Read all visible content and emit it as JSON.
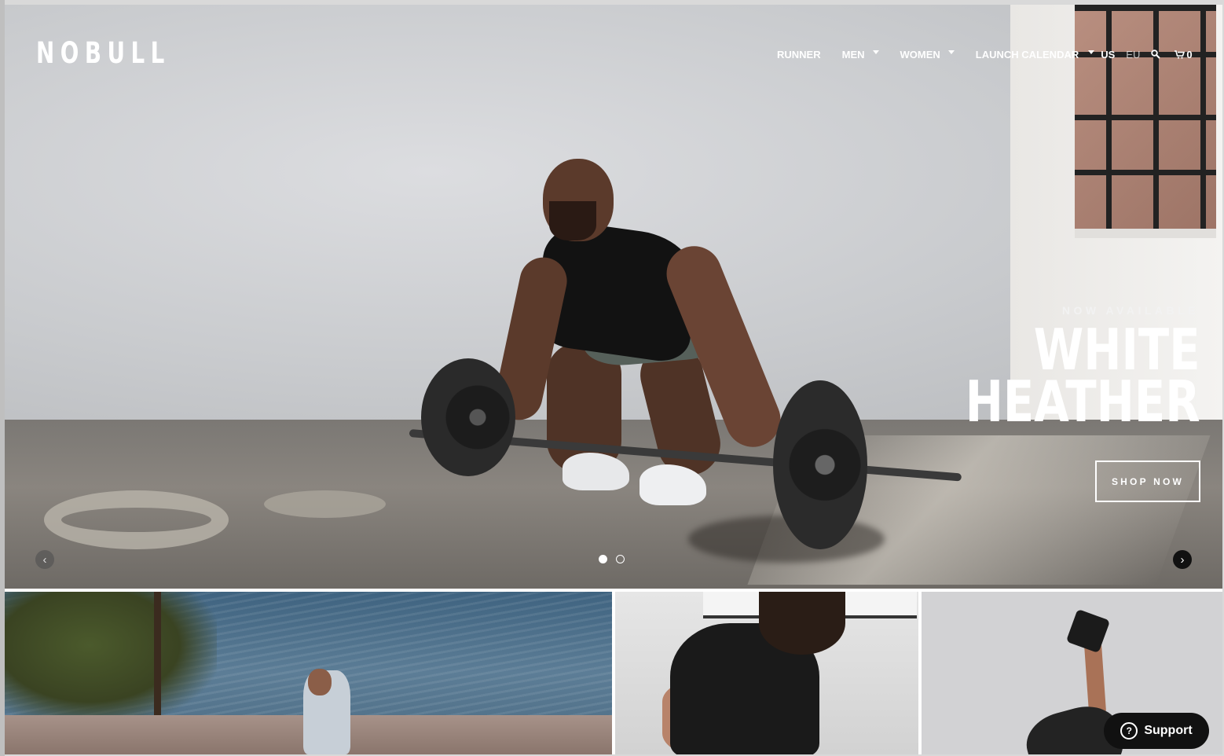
{
  "brand": {
    "logo_text": "NOBULL"
  },
  "nav": {
    "items": [
      {
        "label": "RUNNER",
        "has_dropdown": false
      },
      {
        "label": "MEN",
        "has_dropdown": true
      },
      {
        "label": "WOMEN",
        "has_dropdown": true
      },
      {
        "label": "LAUNCH CALENDAR",
        "has_dropdown": true
      }
    ],
    "region_us": "US",
    "region_eu": "EU",
    "search_icon": "search-icon",
    "cart_icon": "cart-icon",
    "cart_count": "0"
  },
  "hero": {
    "kicker": "NOW AVAILABLE",
    "headline_line1": "WHITE",
    "headline_line2": "HEATHER",
    "cta_label": "SHOP NOW",
    "prev_glyph": "‹",
    "next_glyph": "›",
    "slide_count": 2,
    "active_slide": 1
  },
  "support": {
    "label": "Support",
    "glyph": "?"
  },
  "colors": {
    "text_on_image": "#ffffff",
    "support_bg": "#111111"
  }
}
